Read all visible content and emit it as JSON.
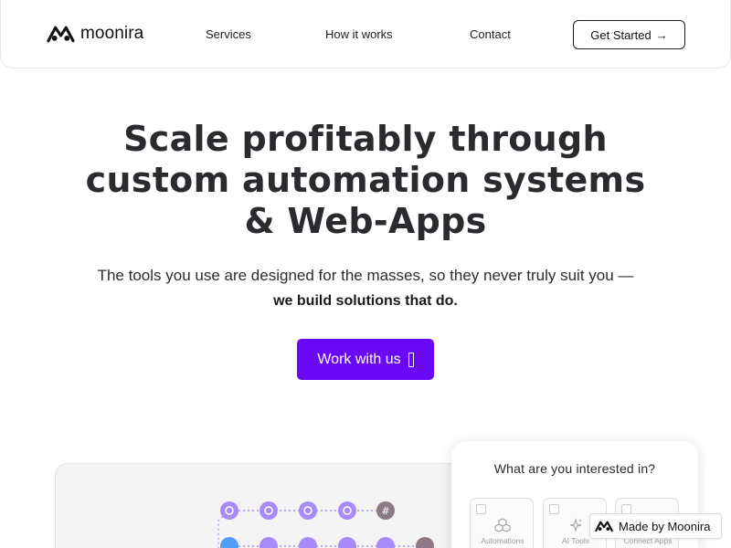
{
  "header": {
    "brand": "moonira",
    "nav": [
      "Services",
      "How it works",
      "Contact"
    ],
    "cta_label": "Get Started",
    "cta_arrow": "→"
  },
  "hero": {
    "title_lines": [
      "Scale profitably through",
      "custom automation systems",
      "& Web-Apps"
    ],
    "subtitle": "The tools you use are designed for the masses, so they never truly suit you —",
    "subtitle_bold": "we build solutions that do.",
    "button_label": "Work with us"
  },
  "interest_panel": {
    "title": "What are you interested in?",
    "options": [
      {
        "label": "Automations",
        "icon": "cubes-icon"
      },
      {
        "label": "AI Tools",
        "icon": "sparkle-icon"
      },
      {
        "label": "Connect Apps",
        "icon": "link-icon"
      }
    ]
  },
  "badge": {
    "label": "Made by Moonira"
  },
  "colors": {
    "accent": "#6a0af5",
    "node": "#a78bfa",
    "node_dark": "#8b7a86",
    "node_blue": "#4f9cf9"
  }
}
